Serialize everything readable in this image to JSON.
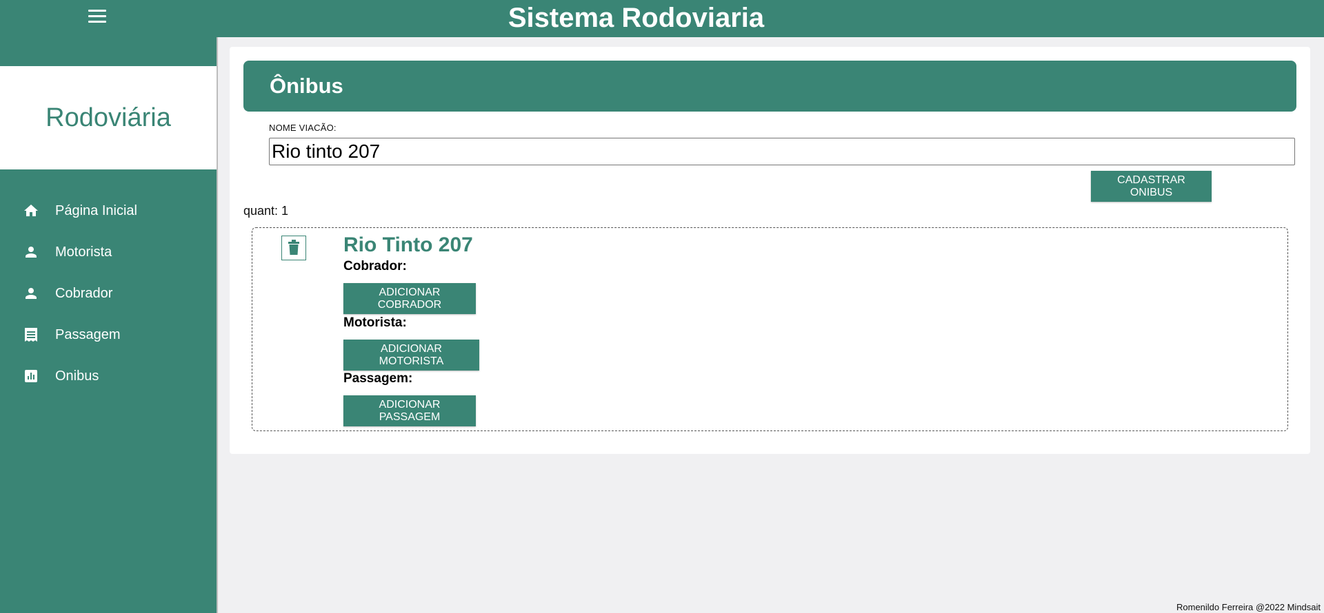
{
  "header": {
    "title": "Sistema Rodoviaria",
    "menu_icon": "hamburger-menu-icon",
    "color": "#3a8575"
  },
  "sidebar": {
    "brand": "Rodoviária",
    "items": [
      {
        "label": "Página Inicial",
        "icon": "home-icon"
      },
      {
        "label": "Motorista",
        "icon": "person-icon"
      },
      {
        "label": "Cobrador",
        "icon": "person-icon"
      },
      {
        "label": "Passagem",
        "icon": "receipt-icon"
      },
      {
        "label": "Onibus",
        "icon": "bar-chart-icon"
      }
    ]
  },
  "main": {
    "page_title": "Ônibus",
    "form": {
      "label": "NOME VIACÃO:",
      "value": "Rio tinto 207",
      "submit_label": "CADASTRAR ONIBUS"
    },
    "quant_text": "quant: 1",
    "items": [
      {
        "title": "Rio Tinto 207",
        "delete_icon": "trash-icon",
        "cobrador_label": "Cobrador:",
        "add_cobrador": "ADICIONAR COBRADOR",
        "motorista_label": "Motorista:",
        "add_motorista": "ADICIONAR MOTORISTA",
        "passagem_label": "Passagem:",
        "add_passagem": "ADICIONAR PASSAGEM"
      }
    ]
  },
  "footer": {
    "text": "Romenildo Ferreira @2022 Mindsait"
  }
}
